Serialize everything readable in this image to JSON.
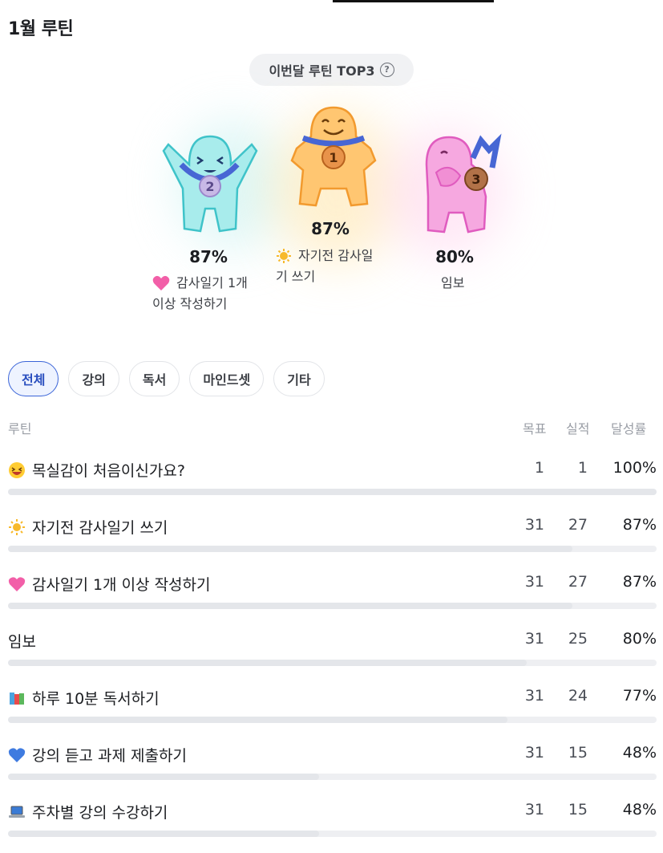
{
  "page_title": "1월 루틴",
  "top3": {
    "pill_label": "이번달 루틴 TOP3",
    "help_icon": "?",
    "ranks": [
      {
        "rank": "1",
        "percent": "87%",
        "icon": "sun-icon",
        "label_line1": "자기전 감사일",
        "label_line2": "기 쓰기"
      },
      {
        "rank": "2",
        "percent": "87%",
        "icon": "pink-heart-icon",
        "label_line1": "감사일기 1개",
        "label_line2": "이상 작성하기"
      },
      {
        "rank": "3",
        "percent": "80%",
        "icon": "",
        "label_line1": "임보",
        "label_line2": ""
      }
    ]
  },
  "tabs": [
    "전체",
    "강의",
    "독서",
    "마인드셋",
    "기타"
  ],
  "active_tab": "전체",
  "table": {
    "headers": {
      "name": "루틴",
      "goal": "목표",
      "done": "실적",
      "rate": "달성률"
    },
    "rows": [
      {
        "icon": "laughing-face-icon",
        "name": "목실감이 처음이신가요?",
        "goal": "1",
        "done": "1",
        "rate": "100%",
        "fill": 1.0
      },
      {
        "icon": "sun-icon",
        "name": "자기전 감사일기 쓰기",
        "goal": "31",
        "done": "27",
        "rate": "87%",
        "fill": 0.87
      },
      {
        "icon": "pink-heart-icon",
        "name": "감사일기 1개 이상 작성하기",
        "goal": "31",
        "done": "27",
        "rate": "87%",
        "fill": 0.87
      },
      {
        "icon": "",
        "name": "임보",
        "goal": "31",
        "done": "25",
        "rate": "80%",
        "fill": 0.8
      },
      {
        "icon": "books-icon",
        "name": "하루 10분 독서하기",
        "goal": "31",
        "done": "24",
        "rate": "77%",
        "fill": 0.77
      },
      {
        "icon": "blue-heart-icon",
        "name": "강의 듣고 과제 제출하기",
        "goal": "31",
        "done": "15",
        "rate": "48%",
        "fill": 0.48
      },
      {
        "icon": "laptop-icon",
        "name": "주차별 강의 수강하기",
        "goal": "31",
        "done": "15",
        "rate": "48%",
        "fill": 0.48
      }
    ]
  },
  "colors": {
    "accent": "#3a64d8",
    "gold": "#f7b24a",
    "silver": "#9ee3e6",
    "bronze": "#f29bd6"
  }
}
